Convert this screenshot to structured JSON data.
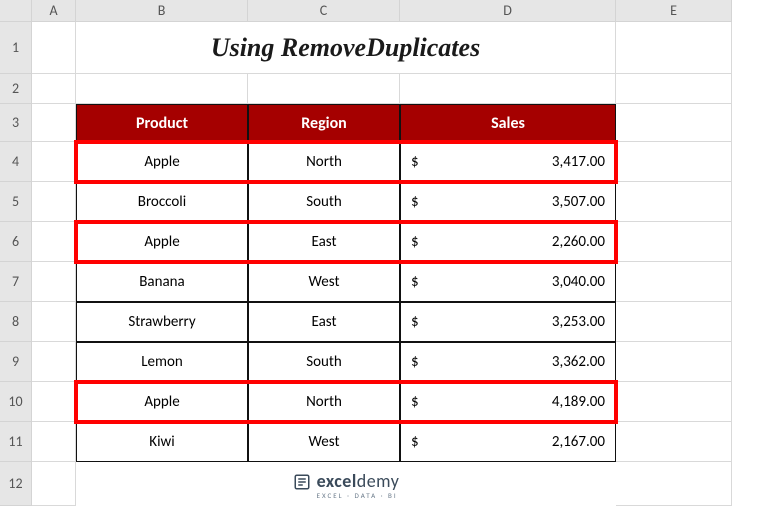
{
  "columns": [
    "A",
    "B",
    "C",
    "D",
    "E"
  ],
  "rows": [
    "1",
    "2",
    "3",
    "4",
    "5",
    "6",
    "7",
    "8",
    "9",
    "10",
    "11",
    "12"
  ],
  "title": "Using RemoveDuplicates",
  "table": {
    "headers": {
      "product": "Product",
      "region": "Region",
      "sales": "Sales"
    },
    "currency": "$",
    "rows": [
      {
        "product": "Apple",
        "region": "North",
        "sales": "3,417.00",
        "highlight": true
      },
      {
        "product": "Broccoli",
        "region": "South",
        "sales": "3,507.00",
        "highlight": false
      },
      {
        "product": "Apple",
        "region": "East",
        "sales": "2,260.00",
        "highlight": true
      },
      {
        "product": "Banana",
        "region": "West",
        "sales": "3,040.00",
        "highlight": false
      },
      {
        "product": "Strawberry",
        "region": "East",
        "sales": "3,253.00",
        "highlight": false
      },
      {
        "product": "Lemon",
        "region": "South",
        "sales": "3,362.00",
        "highlight": false
      },
      {
        "product": "Apple",
        "region": "North",
        "sales": "4,189.00",
        "highlight": true
      },
      {
        "product": "Kiwi",
        "region": "West",
        "sales": "2,167.00",
        "highlight": false
      }
    ]
  },
  "footer": {
    "brand_bold": "excel",
    "brand_rest": "demy",
    "tagline": "EXCEL · DATA · BI"
  },
  "chart_data": {
    "type": "table",
    "title": "Using RemoveDuplicates",
    "columns": [
      "Product",
      "Region",
      "Sales"
    ],
    "rows": [
      [
        "Apple",
        "North",
        3417.0
      ],
      [
        "Broccoli",
        "South",
        3507.0
      ],
      [
        "Apple",
        "East",
        2260.0
      ],
      [
        "Banana",
        "West",
        3040.0
      ],
      [
        "Strawberry",
        "East",
        3253.0
      ],
      [
        "Lemon",
        "South",
        3362.0
      ],
      [
        "Apple",
        "North",
        4189.0
      ],
      [
        "Kiwi",
        "West",
        2167.0
      ]
    ],
    "highlighted_row_indices": [
      0,
      2,
      6
    ]
  }
}
